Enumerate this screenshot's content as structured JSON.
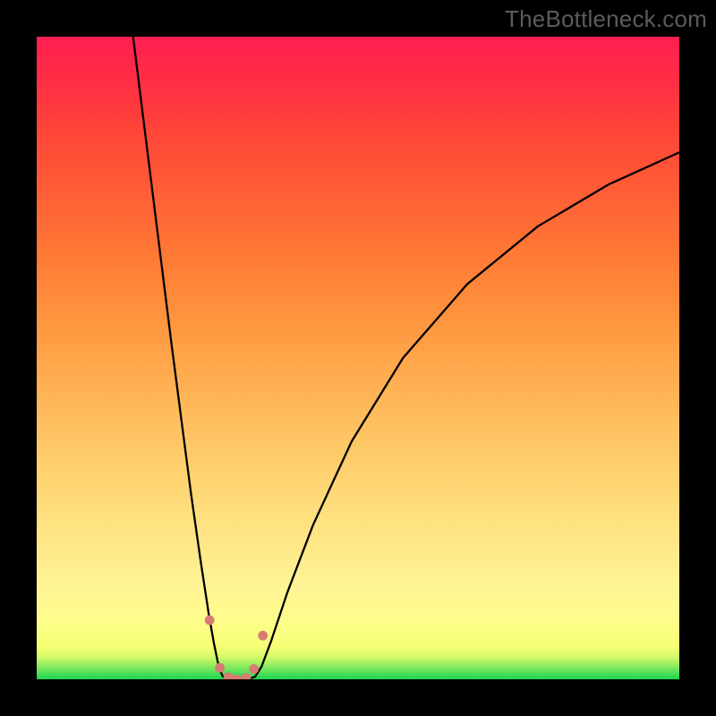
{
  "watermark": "TheBottleneck.com",
  "chart_data": {
    "type": "line",
    "title": "",
    "xlabel": "",
    "ylabel": "",
    "xlim": [
      0,
      100
    ],
    "ylim": [
      0,
      100
    ],
    "grid": false,
    "series": [
      {
        "name": "left-curve",
        "x": [
          15.0,
          16.5,
          18.0,
          19.5,
          21.0,
          22.5,
          24.0,
          25.5,
          26.8,
          27.6,
          28.2,
          28.6,
          29.0
        ],
        "y": [
          100.0,
          88.0,
          76.0,
          64.0,
          52.0,
          40.5,
          29.0,
          18.5,
          10.0,
          5.5,
          2.6,
          1.2,
          0.4
        ]
      },
      {
        "name": "right-curve",
        "x": [
          34.0,
          35.0,
          36.5,
          39.0,
          43.0,
          49.0,
          57.0,
          67.0,
          78.0,
          89.0,
          100.0
        ],
        "y": [
          0.4,
          2.0,
          6.0,
          13.5,
          24.0,
          37.0,
          50.0,
          61.5,
          70.5,
          77.0,
          82.0
        ]
      },
      {
        "name": "trough",
        "x": [
          29.0,
          29.7,
          30.5,
          31.5,
          32.5,
          33.2,
          34.0
        ],
        "y": [
          0.4,
          0.15,
          0.05,
          0.0,
          0.05,
          0.15,
          0.4
        ]
      }
    ],
    "markers": {
      "name": "trough-markers",
      "color": "#d87b74",
      "radius_frac": 0.0075,
      "points": [
        {
          "x": 26.9,
          "y": 9.2
        },
        {
          "x": 28.5,
          "y": 1.8
        },
        {
          "x": 29.8,
          "y": 0.35
        },
        {
          "x": 31.1,
          "y": 0.0
        },
        {
          "x": 32.6,
          "y": 0.25
        },
        {
          "x": 33.8,
          "y": 1.6
        },
        {
          "x": 35.2,
          "y": 6.8
        }
      ]
    },
    "gradient_stops": [
      {
        "pos": 0.0,
        "color": "#1bd551"
      },
      {
        "pos": 0.05,
        "color": "#f6ff73"
      },
      {
        "pos": 0.5,
        "color": "#ffa548"
      },
      {
        "pos": 1.0,
        "color": "#ff1e52"
      }
    ]
  }
}
